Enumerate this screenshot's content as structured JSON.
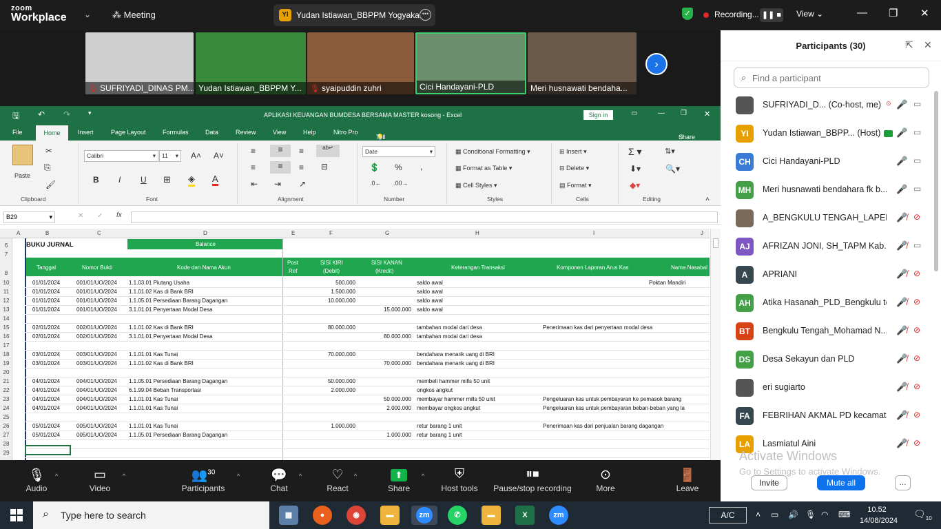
{
  "zoom": {
    "logo_line1": "zoom",
    "logo_line2": "Workplace",
    "meeting_label": "Meeting",
    "speaker_avatar": "YI",
    "speaker_name": "Yudan Istiawan_BBPPM Yogyaka",
    "recording_label": "Recording...",
    "view_label": "View",
    "tiles": [
      {
        "name": "SUFRIYADI_DINAS PM...",
        "muted": true,
        "bg": "#cfcfcf"
      },
      {
        "name": "Yudan Istiawan_BBPPM Y...",
        "muted": false,
        "bg": "#3a8a3c"
      },
      {
        "name": "syaipuddin zuhri",
        "muted": true,
        "bg": "#8a5a3a"
      },
      {
        "name": "Cici Handayani-PLD",
        "muted": false,
        "bg": "#6a8f6a"
      },
      {
        "name": "Meri husnawati bendaha...",
        "muted": false,
        "bg": "#6b5a4a"
      }
    ],
    "toolbar": [
      {
        "label": "Audio",
        "icon": "mic-off-icon",
        "glyph": "🎙"
      },
      {
        "label": "Video",
        "icon": "video-icon",
        "glyph": "📹"
      },
      {
        "label": "Participants",
        "icon": "participants-icon",
        "glyph": "👥",
        "count": "30"
      },
      {
        "label": "Chat",
        "icon": "chat-icon",
        "glyph": "💬"
      },
      {
        "label": "React",
        "icon": "react-icon",
        "glyph": "♡"
      },
      {
        "label": "Share",
        "icon": "share-icon",
        "glyph": "⬆"
      },
      {
        "label": "Host tools",
        "icon": "host-tools-icon",
        "glyph": "⛨"
      },
      {
        "label": "Pause/stop recording",
        "icon": "pause-stop-recording-icon",
        "glyph": "⏸⏹"
      },
      {
        "label": "More",
        "icon": "more-icon",
        "glyph": "⋯"
      },
      {
        "label": "Leave",
        "icon": "leave-icon",
        "glyph": "🚪"
      }
    ]
  },
  "excel": {
    "title": "APLIKASI KEUANGAN BUMDESA BERSAMA MASTER  kosong  -  Excel",
    "sign_in": "Sign in",
    "tabs": [
      "File",
      "Home",
      "Insert",
      "Page Layout",
      "Formulas",
      "Data",
      "Review",
      "View",
      "Help",
      "Nitro Pro"
    ],
    "tell_me": "Tell me what you want to do",
    "share": "Share",
    "ribbon": {
      "paste": "Paste",
      "clipboard": "Clipboard",
      "font_name": "Calibri",
      "font_size": "11",
      "font": "Font",
      "alignment": "Alignment",
      "number_format": "Date",
      "number": "Number",
      "cond_format": "Conditional Formatting",
      "format_table": "Format as Table",
      "cell_styles": "Cell Styles",
      "styles": "Styles",
      "insert": "Insert",
      "delete": "Delete",
      "format": "Format",
      "cells": "Cells",
      "editing": "Editing"
    },
    "name_box": "B29",
    "columns": [
      "A",
      "B",
      "C",
      "D",
      "E",
      "F",
      "G",
      "H",
      "I",
      "J"
    ],
    "title_cell": "BUKU JURNAL",
    "balance": "Balance",
    "headers": {
      "tanggal": "Tanggal",
      "nomor": "Nomor Bukti",
      "kode": "Kode dan Nama Akun",
      "post1": "Post",
      "post2": "Ref",
      "kiri1": "SISI KIRI",
      "kiri2": "(Debit)",
      "kanan1": "SISI KANAN",
      "kanan2": "(Kredit)",
      "ket": "Keterangan Transaksi",
      "komp": "Komponen Laporan Arus Kas",
      "nama": "Nama Nasabal"
    },
    "rows": [
      {
        "r": "10",
        "tgl": "01/01/2024",
        "no": "001/01/UO/2024",
        "akun": "1.1.03.01 Piutang Usaha",
        "debit": "500.000",
        "kredit": "",
        "ket": "saldo awal",
        "komp": "",
        "nama": "Poktan Mandiri"
      },
      {
        "r": "11",
        "tgl": "01/01/2024",
        "no": "001/01/UO/2024",
        "akun": "1.1.01.02 Kas di Bank BRI",
        "debit": "1.500.000",
        "kredit": "",
        "ket": "saldo awal",
        "komp": "",
        "nama": ""
      },
      {
        "r": "12",
        "tgl": "01/01/2024",
        "no": "001/01/UO/2024",
        "akun": "1.1.05.01 Persediaan Barang Dagangan",
        "debit": "10.000.000",
        "kredit": "",
        "ket": "saldo awal",
        "komp": "",
        "nama": ""
      },
      {
        "r": "13",
        "tgl": "01/01/2024",
        "no": "001/01/UO/2024",
        "akun": "3.1.01.01 Penyertaan Modal Desa",
        "debit": "",
        "kredit": "15.000.000",
        "ket": "saldo awal",
        "komp": "",
        "nama": ""
      },
      {
        "r": "14",
        "tgl": "",
        "no": "",
        "akun": "",
        "debit": "",
        "kredit": "",
        "ket": "",
        "komp": "",
        "nama": ""
      },
      {
        "r": "15",
        "tgl": "02/01/2024",
        "no": "002/01/UO/2024",
        "akun": "1.1.01.02 Kas di Bank BRI",
        "debit": "80.000.000",
        "kredit": "",
        "ket": "tambahan modal dari desa",
        "komp": "Penerimaan kas dari penyertaan modal desa",
        "nama": ""
      },
      {
        "r": "16",
        "tgl": "02/01/2024",
        "no": "002/01/UO/2024",
        "akun": "3.1.01.01 Penyertaan Modal Desa",
        "debit": "",
        "kredit": "80.000.000",
        "ket": "tambahan modal dari desa",
        "komp": "",
        "nama": ""
      },
      {
        "r": "17",
        "tgl": "",
        "no": "",
        "akun": "",
        "debit": "",
        "kredit": "",
        "ket": "",
        "komp": "",
        "nama": ""
      },
      {
        "r": "18",
        "tgl": "03/01/2024",
        "no": "003/01/UO/2024",
        "akun": "1.1.01.01 Kas Tunai",
        "debit": "70.000.000",
        "kredit": "",
        "ket": "bendahara menarik uang di BRI",
        "komp": "",
        "nama": ""
      },
      {
        "r": "19",
        "tgl": "03/01/2024",
        "no": "003/01/UO/2024",
        "akun": "1.1.01.02 Kas di Bank BRI",
        "debit": "",
        "kredit": "70.000.000",
        "ket": "bendahara menarik uang di BRI",
        "komp": "",
        "nama": ""
      },
      {
        "r": "20",
        "tgl": "",
        "no": "",
        "akun": "",
        "debit": "",
        "kredit": "",
        "ket": "",
        "komp": "",
        "nama": ""
      },
      {
        "r": "21",
        "tgl": "04/01/2024",
        "no": "004/01/UO/2024",
        "akun": "1.1.05.01 Persediaan Barang Dagangan",
        "debit": "50.000.000",
        "kredit": "",
        "ket": "membeli hammer mills 50 unit",
        "komp": "",
        "nama": ""
      },
      {
        "r": "22",
        "tgl": "04/01/2024",
        "no": "004/01/UO/2024",
        "akun": "6.1.99.04 Beban Transportasi",
        "debit": "2.000.000",
        "kredit": "",
        "ket": "ongkos angkut",
        "komp": "",
        "nama": ""
      },
      {
        "r": "23",
        "tgl": "04/01/2024",
        "no": "004/01/UO/2024",
        "akun": "1.1.01.01 Kas Tunai",
        "debit": "",
        "kredit": "50.000.000",
        "ket": "membayar hammer mills 50 unit",
        "komp": "Pengeluaran kas untuk pembayaran ke pemasok barang",
        "nama": ""
      },
      {
        "r": "24",
        "tgl": "04/01/2024",
        "no": "004/01/UO/2024",
        "akun": "1.1.01.01 Kas Tunai",
        "debit": "",
        "kredit": "2.000.000",
        "ket": "membayar ongkos angkut",
        "komp": "Pengeluaran kas untuk pembayaran beban-beban yang la",
        "nama": ""
      },
      {
        "r": "25",
        "tgl": "",
        "no": "",
        "akun": "",
        "debit": "",
        "kredit": "",
        "ket": "",
        "komp": "",
        "nama": ""
      },
      {
        "r": "26",
        "tgl": "05/01/2024",
        "no": "005/01/UO/2024",
        "akun": "1.1.01.01 Kas Tunai",
        "debit": "1.000.000",
        "kredit": "",
        "ket": "retur barang 1 unit",
        "komp": "Penerimaan kas dari penjualan barang dagangan",
        "nama": ""
      },
      {
        "r": "27",
        "tgl": "05/01/2024",
        "no": "005/01/UO/2024",
        "akun": "1.1.05.01 Persediaan Barang Dagangan",
        "debit": "",
        "kredit": "1.000.000",
        "ket": "retur barang 1 unit",
        "komp": "",
        "nama": ""
      },
      {
        "r": "28",
        "tgl": "",
        "no": "",
        "akun": "",
        "debit": "",
        "kredit": "",
        "ket": "",
        "komp": "",
        "nama": ""
      },
      {
        "r": "29",
        "tgl": "",
        "no": "",
        "akun": "",
        "debit": "",
        "kredit": "",
        "ket": "",
        "komp": "",
        "nama": ""
      }
    ]
  },
  "participants": {
    "title": "Participants (30)",
    "search_placeholder": "Find a participant",
    "list": [
      {
        "initials": "",
        "color": "#555",
        "name": "SUFRIYADI_D... (Co-host, me)",
        "mic": "on",
        "cam": "off",
        "extra": "●"
      },
      {
        "initials": "YI",
        "color": "#e6a100",
        "name": "Yudan Istiawan_BBPP... (Host)",
        "mic": "on",
        "cam": "off",
        "extra": ""
      },
      {
        "initials": "CH",
        "color": "#3a7bd5",
        "name": "Cici Handayani-PLD",
        "mic": "on",
        "cam": "off",
        "extra": ""
      },
      {
        "initials": "MH",
        "color": "#43a047",
        "name": "Meri husnawati bendahara fk b...",
        "mic": "on",
        "cam": "off",
        "extra": ""
      },
      {
        "initials": "",
        "color": "#7a6a5a",
        "name": "A_BENGKULU TENGAH_LAPENDI",
        "mic": "muted",
        "cam": "muted",
        "extra": ""
      },
      {
        "initials": "AJ",
        "color": "#7e57c2",
        "name": "AFRIZAN JONI, SH_TAPM Kab. ...",
        "mic": "muted",
        "cam": "off",
        "extra": ""
      },
      {
        "initials": "A",
        "color": "#37474f",
        "name": "APRIANI",
        "mic": "muted",
        "cam": "muted",
        "extra": ""
      },
      {
        "initials": "AH",
        "color": "#43a047",
        "name": "Atika Hasanah_PLD_Bengkulu te...",
        "mic": "muted",
        "cam": "muted",
        "extra": ""
      },
      {
        "initials": "BT",
        "color": "#d84315",
        "name": "Bengkulu Tengah_Mohamad N...",
        "mic": "muted",
        "cam": "muted",
        "extra": ""
      },
      {
        "initials": "DS",
        "color": "#43a047",
        "name": "Desa Sekayun dan PLD",
        "mic": "muted",
        "cam": "muted",
        "extra": ""
      },
      {
        "initials": "",
        "color": "#555",
        "name": "eri sugiarto",
        "mic": "muted",
        "cam": "muted",
        "extra": ""
      },
      {
        "initials": "FA",
        "color": "#37474f",
        "name": "FEBRIHAN AKMAL PD kecamat...",
        "mic": "muted",
        "cam": "muted",
        "extra": ""
      },
      {
        "initials": "LA",
        "color": "#e6a100",
        "name": "Lasmiatul Aini",
        "mic": "muted",
        "cam": "muted",
        "extra": ""
      }
    ],
    "watermark1": "Activate Windows",
    "watermark2": "Go to Settings to activate Windows.",
    "invite": "Invite",
    "mute_all": "Mute all",
    "more": "..."
  },
  "taskbar": {
    "search_placeholder": "Type here to search",
    "ac": "A/C",
    "time": "10.52",
    "date": "14/08/2024",
    "notifications": "10"
  }
}
